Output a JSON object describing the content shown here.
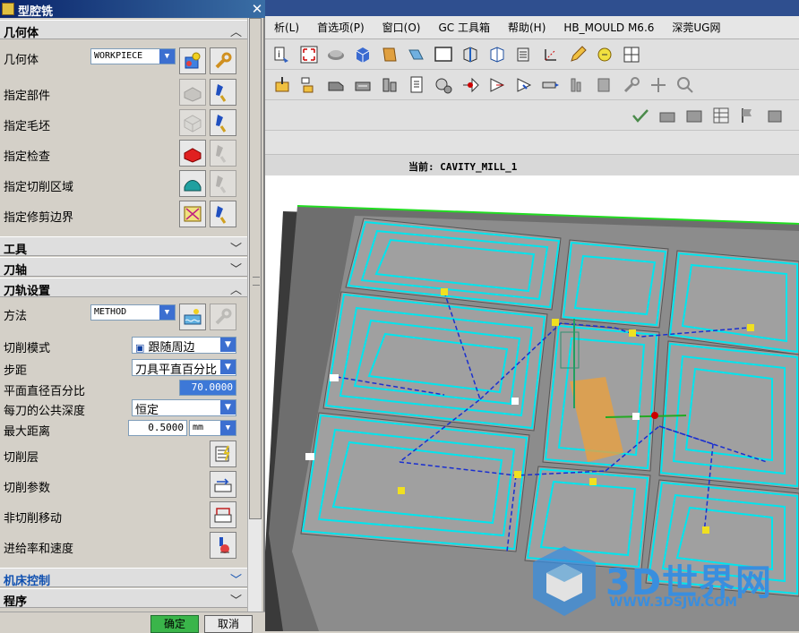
{
  "dialog": {
    "title": "型腔铣",
    "close_symbol": "✕",
    "sections": {
      "geometry": "几何体",
      "tool": "工具",
      "tool_axis": "刀轴",
      "path_settings": "刀轨设置",
      "machine_control": "机床控制",
      "program": "程序"
    },
    "geometry": {
      "geometry_label": "几何体",
      "geometry_value": "WORKPIECE",
      "part_label": "指定部件",
      "blank_label": "指定毛坯",
      "check_label": "指定检查",
      "cut_area_label": "指定切削区域",
      "trim_label": "指定修剪边界"
    },
    "path": {
      "method_label": "方法",
      "method_value": "METHOD",
      "cut_mode_label": "切削模式",
      "cut_mode_value": "跟随周边",
      "stepover_label": "步距",
      "stepover_value": "刀具平直百分比",
      "flat_pct_label": "平面直径百分比",
      "flat_pct_value": "70.0000",
      "depth_label": "每刀的公共深度",
      "depth_value": "恒定",
      "max_dist_label": "最大距离",
      "max_dist_value": "0.5000",
      "max_dist_unit": "mm",
      "levels_label": "切削层",
      "params_label": "切削参数",
      "noncut_label": "非切削移动",
      "feeds_label": "进给率和速度"
    },
    "ok_label": "确定",
    "cancel_label": "取消"
  },
  "menu": [
    "析(L)",
    "首选项(P)",
    "窗口(O)",
    "GC 工具箱",
    "帮助(H)",
    "HB_MOULD M6.6",
    "深莞UG网"
  ],
  "current_op": "当前: CAVITY_MILL_1",
  "watermark": {
    "text": "3D世界网",
    "url": "WWW.3DSJW.COM"
  },
  "colors": {
    "toolpath": "#00e5ee",
    "rapid": "#1a2fd0",
    "dialog_title": "#0a246a"
  }
}
